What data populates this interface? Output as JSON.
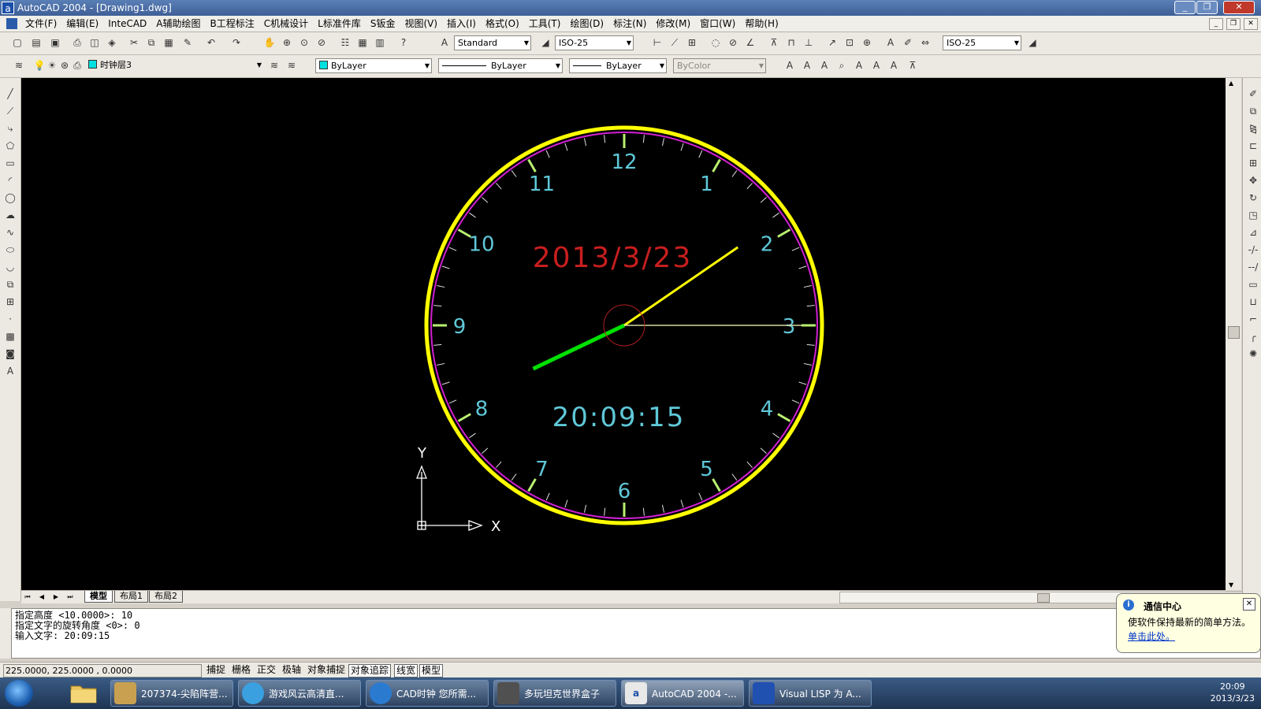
{
  "window": {
    "title": "AutoCAD 2004 - [Drawing1.dwg]"
  },
  "menu": [
    "文件(F)",
    "编辑(E)",
    "InteCAD",
    "A辅助绘图",
    "B工程标注",
    "C机械设计",
    "L标准件库",
    "S钣金",
    "视图(V)",
    "插入(I)",
    "格式(O)",
    "工具(T)",
    "绘图(D)",
    "标注(N)",
    "修改(M)",
    "窗口(W)",
    "帮助(H)"
  ],
  "toolbar": {
    "text_style": "Standard",
    "dim_style": "ISO-25",
    "dim_style_right": "ISO-25",
    "layer": "时钟层3",
    "color": "ByLayer",
    "linetype": "ByLayer",
    "lineweight": "ByLayer",
    "plotstyle": "ByColor"
  },
  "drawing": {
    "date_text": "2013/3/23",
    "time_text": "20:09:15",
    "numerals": [
      "12",
      "1",
      "2",
      "3",
      "4",
      "5",
      "6",
      "7",
      "8",
      "9",
      "10",
      "11"
    ],
    "ucs_x": "X",
    "ucs_y": "Y",
    "time": {
      "hour": 20,
      "minute": 9,
      "second": 15
    },
    "colors": {
      "outer_ring": "#ffff00",
      "inner_ring": "#d020d0",
      "numerals": "#5fc8d8",
      "date": "#c81e1e",
      "hour_hand": "#00e000",
      "minute_hand": "#ffff00",
      "second_hand": "#d8d8a0",
      "hub": "#b02020"
    }
  },
  "layout_tabs": [
    "模型",
    "布局1",
    "布局2"
  ],
  "command_lines": [
    "指定高度 <10.0000>: 10",
    "指定文字的旋转角度 <0>: 0",
    "输入文字: 20:09:15"
  ],
  "status": {
    "coords": "225.0000, 225.0000 , 0.0000",
    "buttons": [
      "捕捉",
      "栅格",
      "正交",
      "极轴",
      "对象捕捉",
      "对象追踪",
      "线宽",
      "模型"
    ]
  },
  "notification": {
    "title": "通信中心",
    "message": "使软件保持最新的简单方法。",
    "link": "单击此处。"
  },
  "taskbar": {
    "items": [
      "207374-尖陷阵营...",
      "游戏风云高清直...",
      "CAD时钟 您所需...",
      "多玩坦克世界盒子",
      "AutoCAD 2004 -...",
      "Visual LISP 为 A..."
    ],
    "clock_time": "20:09",
    "clock_date": "2013/3/23"
  }
}
